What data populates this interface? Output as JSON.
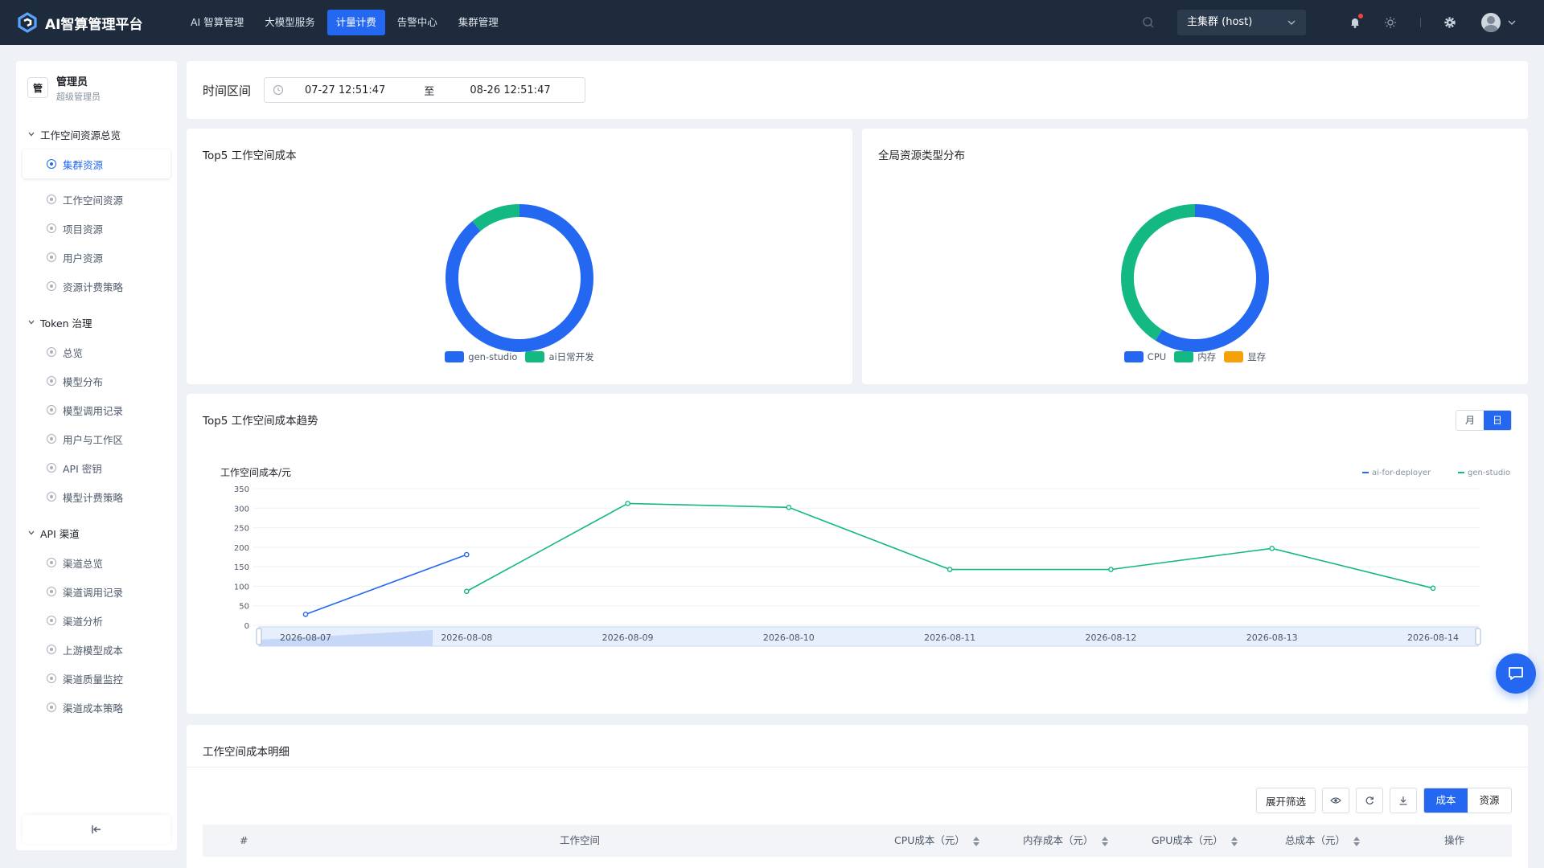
{
  "app": {
    "title": "AI智算管理平台"
  },
  "nav": [
    "AI 智算管理",
    "大模型服务",
    "计量计费",
    "告警中心",
    "集群管理"
  ],
  "nav_active": 2,
  "cluster": {
    "label": "主集群 (host)"
  },
  "user": {
    "badge": "管",
    "name": "管理员",
    "role": "超级管理员"
  },
  "sidebar": {
    "groups": [
      {
        "label": "工作空间资源总览",
        "items": [
          "集群资源",
          "工作空间资源",
          "项目资源",
          "用户资源",
          "资源计费策略"
        ]
      },
      {
        "label": "Token 治理",
        "items": [
          "总览",
          "模型分布",
          "模型调用记录",
          "用户与工作区",
          "API 密钥",
          "模型计费策略"
        ]
      },
      {
        "label": "API 渠道",
        "items": [
          "渠道总览",
          "渠道调用记录",
          "渠道分析",
          "上游模型成本",
          "渠道质量监控",
          "渠道成本策略"
        ]
      }
    ],
    "active": "集群资源"
  },
  "time_filter": {
    "label": "时间区间",
    "start": "07-27 12:51:47",
    "sep": "至",
    "end": "08-26 12:51:47"
  },
  "top5_cost": {
    "title": "Top5 工作空间成本",
    "slices": [
      {
        "name": "gen-studio",
        "value": 89,
        "color": "#2468f2"
      },
      {
        "name": "ai日常开发",
        "value": 11,
        "color": "#14b883"
      }
    ]
  },
  "resource_dist": {
    "title": "全局资源类型分布",
    "slices": [
      {
        "name": "CPU",
        "value": 59,
        "color": "#2468f2"
      },
      {
        "name": "内存",
        "value": 41,
        "color": "#14b883"
      },
      {
        "name": "显存",
        "value": 0,
        "color": "#f5a10a"
      }
    ]
  },
  "trend": {
    "title": "Top5 工作空间成本趋势",
    "toggle": [
      "月",
      "日"
    ],
    "toggle_active": 1
  },
  "chart_data": {
    "type": "line",
    "title": "Top5 工作空间成本趋势",
    "ylabel": "工作空间成本/元",
    "ylim": [
      0,
      350
    ],
    "yticks": [
      0,
      50,
      100,
      150,
      200,
      250,
      300,
      350
    ],
    "x": [
      "2026-08-07",
      "2026-08-08",
      "2026-08-09",
      "2026-08-10",
      "2026-08-11",
      "2026-08-12",
      "2026-08-13",
      "2026-08-14"
    ],
    "series": [
      {
        "name": "ai-for-deployer",
        "color": "#2468f2",
        "values": [
          28,
          181,
          null,
          null,
          null,
          null,
          null,
          null
        ]
      },
      {
        "name": "gen-studio",
        "color": "#14b883",
        "values": [
          null,
          87,
          312,
          302,
          143,
          143,
          197,
          95
        ]
      }
    ],
    "legend": "top-right",
    "grid": true
  },
  "detail": {
    "title": "工作空间成本明细",
    "tools": {
      "filter": "展开筛选",
      "seg": [
        "成本",
        "资源"
      ],
      "seg_active": 0
    },
    "columns": [
      "#",
      "工作空间",
      "CPU成本（元）",
      "内存成本（元）",
      "GPU成本（元）",
      "总成本（元）",
      "操作"
    ]
  }
}
